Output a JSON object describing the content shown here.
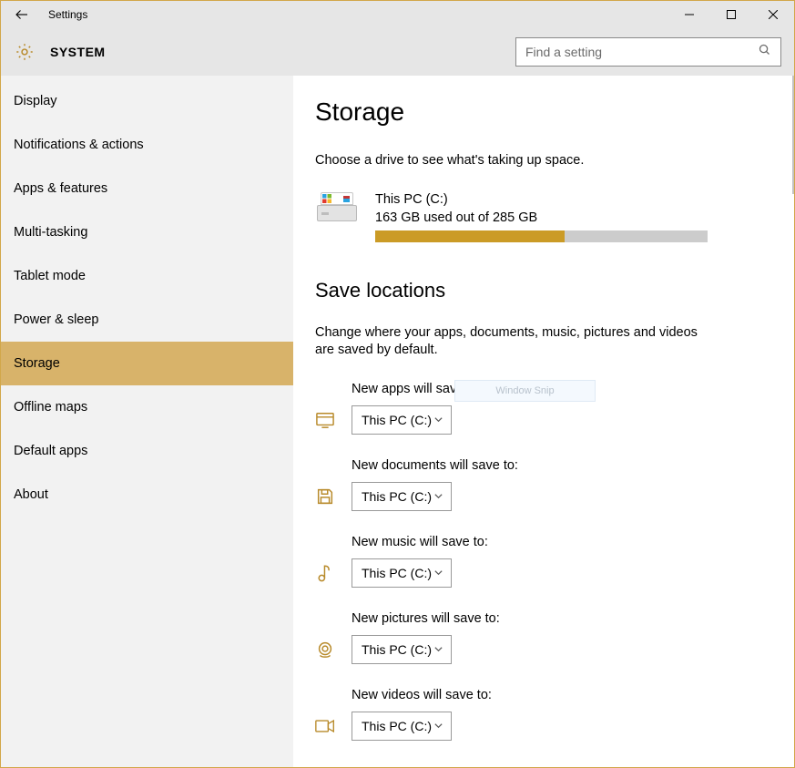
{
  "window": {
    "title": "Settings"
  },
  "header": {
    "title": "SYSTEM"
  },
  "search": {
    "placeholder": "Find a setting"
  },
  "sidebar": {
    "items": [
      {
        "label": "Display"
      },
      {
        "label": "Notifications & actions"
      },
      {
        "label": "Apps & features"
      },
      {
        "label": "Multi-tasking"
      },
      {
        "label": "Tablet mode"
      },
      {
        "label": "Power & sleep"
      },
      {
        "label": "Storage"
      },
      {
        "label": "Offline maps"
      },
      {
        "label": "Default apps"
      },
      {
        "label": "About"
      }
    ],
    "active_index": 6
  },
  "storage": {
    "heading": "Storage",
    "subtext": "Choose a drive to see what's taking up space.",
    "drive": {
      "name": "This PC (C:)",
      "usage_text": "163 GB used out of 285 GB",
      "used_gb": 163,
      "total_gb": 285,
      "fill_percent": 57
    }
  },
  "save_locations": {
    "heading": "Save locations",
    "subtext": "Change where your apps, documents, music, pictures and videos are saved by default.",
    "rows": [
      {
        "label": "New apps will save to:",
        "value": "This PC (C:)",
        "icon": "app-window-icon"
      },
      {
        "label": "New documents will save to:",
        "value": "This PC (C:)",
        "icon": "save-icon"
      },
      {
        "label": "New music will save to:",
        "value": "This PC (C:)",
        "icon": "music-note-icon"
      },
      {
        "label": "New pictures will save to:",
        "value": "This PC (C:)",
        "icon": "camera-icon"
      },
      {
        "label": "New videos will save to:",
        "value": "This PC (C:)",
        "icon": "video-camera-icon"
      }
    ]
  },
  "overlay": {
    "text": "Window Snip"
  },
  "colors": {
    "accent": "#cb9b26",
    "icon": "#b88a2a"
  }
}
